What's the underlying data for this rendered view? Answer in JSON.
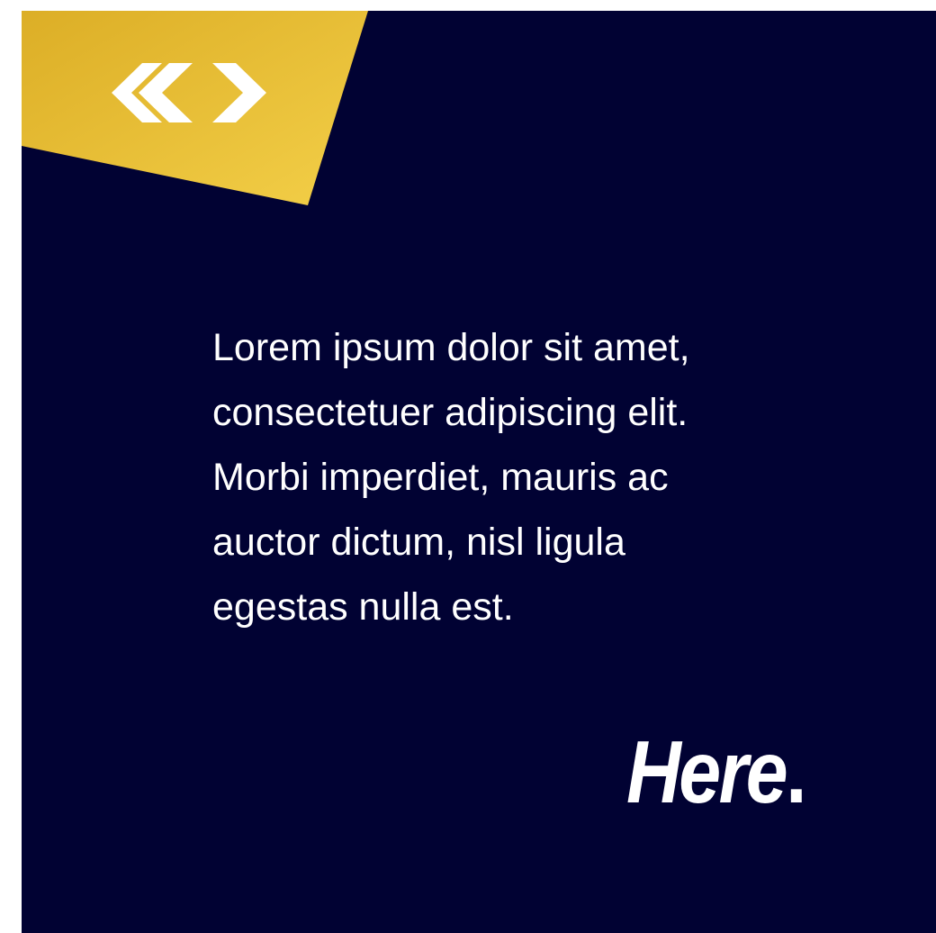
{
  "colors": {
    "background": "#010233",
    "gold": "#e8b829",
    "gold_light": "#f2cf4a",
    "text": "#ffffff"
  },
  "logo": {
    "icon": "double-chevron-logo-icon"
  },
  "body": {
    "lines": [
      "Lorem ipsum dolor sit amet,",
      "consectetuer adipiscing elit.",
      "Morbi imperdiet, mauris ac",
      "auctor dictum, nisl ligula",
      "egestas nulla est."
    ]
  },
  "tagline": {
    "word": "Here",
    "punctuation": "."
  }
}
